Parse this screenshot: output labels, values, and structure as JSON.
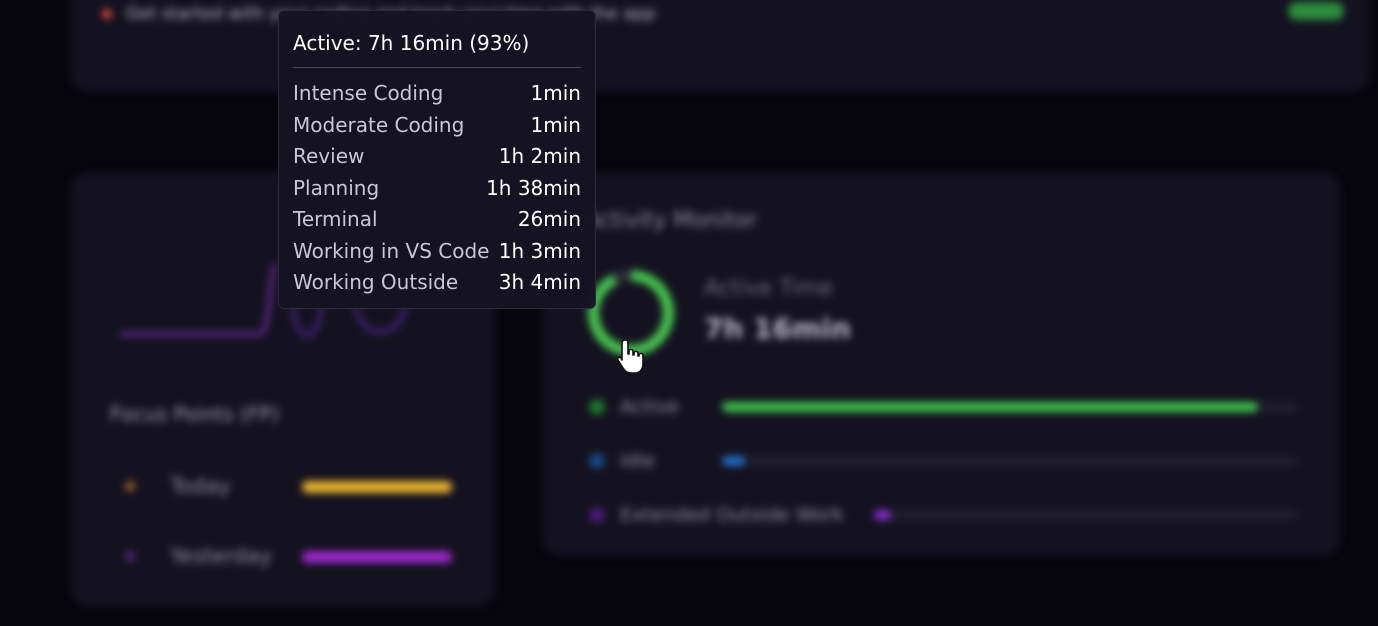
{
  "top_card": {
    "row_text": "Get started with your coding and track your time with the app",
    "meta_text": "",
    "status_color": "#2c8c3d"
  },
  "focus_points": {
    "title": "Focus Points (FP)",
    "rows": [
      {
        "label": "Today",
        "color": "#e6b32e"
      },
      {
        "label": "Yesterday",
        "color": "#9b27c9"
      }
    ]
  },
  "activity_monitor": {
    "title": "Activity Monitor",
    "donut_center": "",
    "active_label": "Active Time",
    "active_value": "7h 16min",
    "active_fraction": 0.93,
    "legend": [
      {
        "label": "Active",
        "color": "#3fc04a",
        "fraction": 0.93
      },
      {
        "label": "Idle",
        "color": "#1f6ec9",
        "fraction": 0.04
      },
      {
        "label": "Extended Outside Work",
        "color": "#8a2ad0",
        "fraction": 0.04
      }
    ]
  },
  "tooltip": {
    "header": "Active: 7h 16min (93%)",
    "rows": [
      {
        "name": "Intense Coding",
        "value": "1min"
      },
      {
        "name": "Moderate Coding",
        "value": "1min"
      },
      {
        "name": "Review",
        "value": "1h 2min"
      },
      {
        "name": "Planning",
        "value": "1h 38min"
      },
      {
        "name": "Terminal",
        "value": "26min"
      },
      {
        "name": "Working in VS Code",
        "value": "1h 3min"
      },
      {
        "name": "Working Outside",
        "value": "3h 4min"
      }
    ]
  },
  "colors": {
    "background": "#06050c",
    "card": "#14121f",
    "active_green": "#46c34f"
  }
}
